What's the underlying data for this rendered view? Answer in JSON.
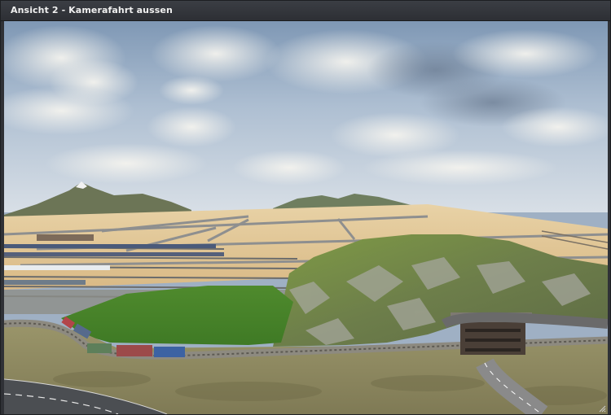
{
  "window": {
    "title": "Ansicht 2 - Kamerafahrt aussen"
  },
  "viewport": {
    "content": "3d-scene",
    "icons": {
      "resize": "resize-grip-icon"
    }
  }
}
